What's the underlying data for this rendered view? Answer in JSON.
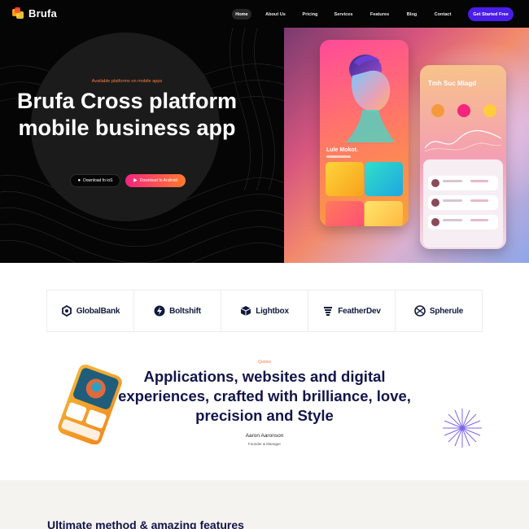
{
  "brand": {
    "name": "Brufa"
  },
  "nav": {
    "items": [
      "Home",
      "About Us",
      "Pricing",
      "Services",
      "Features",
      "Blog",
      "Contact"
    ],
    "cta": "Get Started Free"
  },
  "hero": {
    "eyebrow": "Available platforms on mobile apps",
    "title": "Brufa Cross platform mobile business app",
    "ios_button": "Download fo ioS",
    "android_button": "Download fo Android"
  },
  "mockup": {
    "phone1_name": "Lule Mokot.",
    "phone2_title": "Tmh Suc Miagd"
  },
  "logos": [
    "GlobalBank",
    "Boltshift",
    "Lightbox",
    "FeatherDev",
    "Spherule"
  ],
  "quote": {
    "label": "Quotes",
    "text": "Applications, websites and digital experiences, crafted with brilliance, love, precision and Style",
    "author": "Aaron Aaronson",
    "role": "Founder & Manager"
  },
  "features": {
    "title": "Ultimate method & amazing features"
  },
  "colors": {
    "accent": "#4a1de8",
    "orange": "#ff7a3c",
    "navy": "#12154a",
    "pink": "#f3257e"
  },
  "icons": [
    "apple-icon",
    "play-store-icon",
    "globalbank-logo-icon",
    "boltshift-logo-icon",
    "lightbox-logo-icon",
    "featherdev-logo-icon",
    "spherule-logo-icon",
    "starburst-icon"
  ]
}
